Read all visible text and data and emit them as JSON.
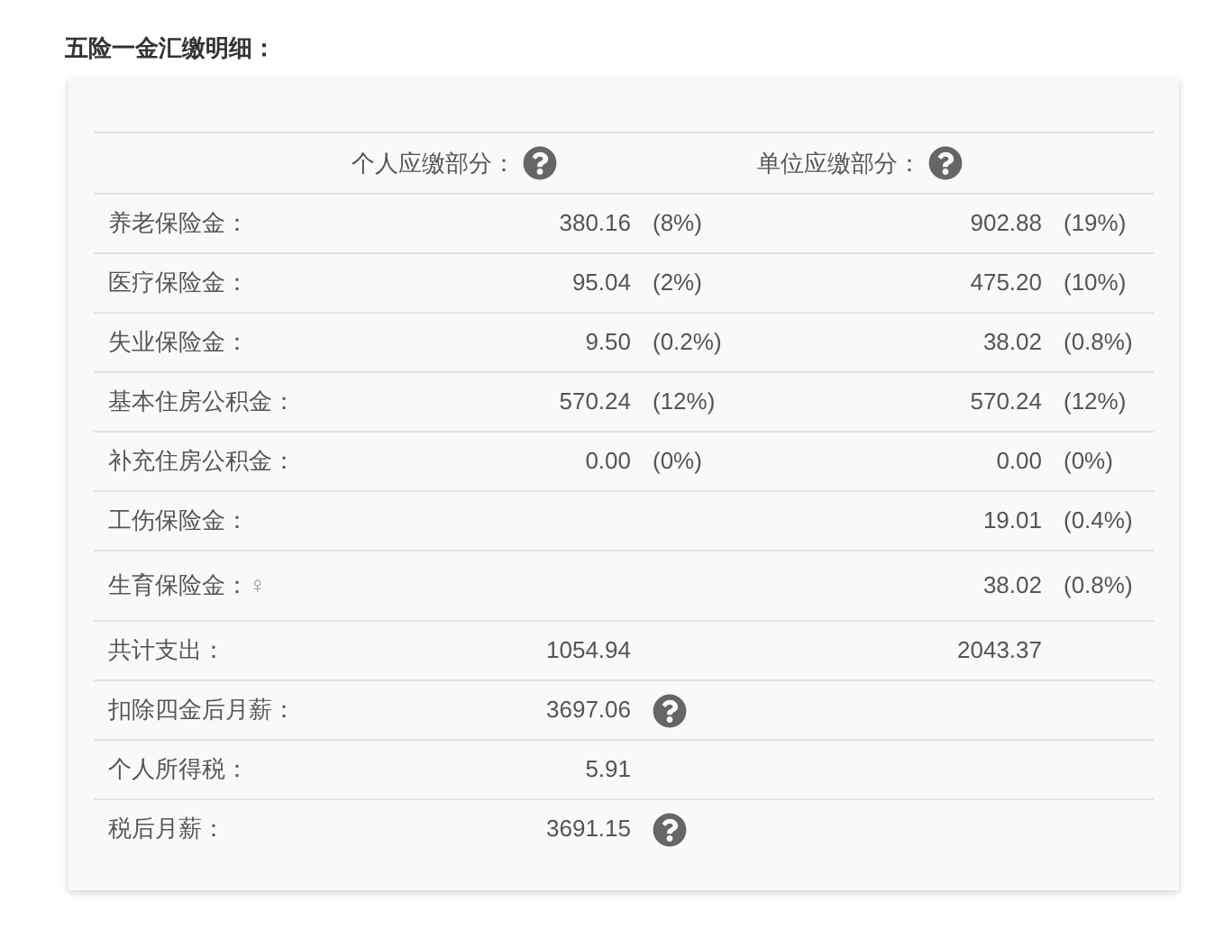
{
  "title": "五险一金汇缴明细：",
  "header": {
    "personal": "个人应缴部分：",
    "company": "单位应缴部分："
  },
  "rows": [
    {
      "label": "养老保险金：",
      "personal": {
        "amount": "380.16",
        "rate": "(8%)"
      },
      "company": {
        "amount": "902.88",
        "rate": "(19%)"
      }
    },
    {
      "label": "医疗保险金：",
      "personal": {
        "amount": "95.04",
        "rate": "(2%)"
      },
      "company": {
        "amount": "475.20",
        "rate": "(10%)"
      }
    },
    {
      "label": "失业保险金：",
      "personal": {
        "amount": "9.50",
        "rate": "(0.2%)"
      },
      "company": {
        "amount": "38.02",
        "rate": "(0.8%)"
      }
    },
    {
      "label": "基本住房公积金：",
      "personal": {
        "amount": "570.24",
        "rate": "(12%)"
      },
      "company": {
        "amount": "570.24",
        "rate": "(12%)"
      }
    },
    {
      "label": "补充住房公积金：",
      "personal": {
        "amount": "0.00",
        "rate": "(0%)"
      },
      "company": {
        "amount": "0.00",
        "rate": "(0%)"
      }
    },
    {
      "label": "工伤保险金：",
      "company": {
        "amount": "19.01",
        "rate": "(0.4%)"
      }
    },
    {
      "label": "生育保险金：",
      "symbol": "♀",
      "company": {
        "amount": "38.02",
        "rate": "(0.8%)"
      }
    }
  ],
  "summary": [
    {
      "label": "共计支出：",
      "personal": "1054.94",
      "company": "2043.37",
      "help": false
    },
    {
      "label": "扣除四金后月薪：",
      "personal": "3697.06",
      "help": true
    },
    {
      "label": "个人所得税：",
      "personal": "5.91",
      "help": false
    },
    {
      "label": "税后月薪：",
      "personal": "3691.15",
      "help": true
    }
  ]
}
